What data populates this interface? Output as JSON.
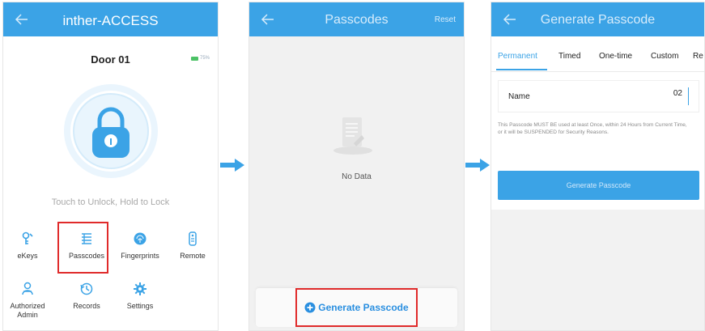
{
  "screen1": {
    "title": "inther-ACCESS",
    "door_name": "Door 01",
    "battery_text": "75%",
    "hint": "Touch to Unlock, Hold to Lock",
    "menu": [
      {
        "label": "eKeys",
        "icon": "ekeys-icon"
      },
      {
        "label": "Passcodes",
        "icon": "passcodes-icon"
      },
      {
        "label": "Fingerprints",
        "icon": "fingerprint-icon"
      },
      {
        "label": "Remote",
        "icon": "remote-icon"
      },
      {
        "label": "Authorized Admin",
        "icon": "admin-icon"
      },
      {
        "label": "Records",
        "icon": "records-icon"
      },
      {
        "label": "Settings",
        "icon": "settings-icon"
      }
    ],
    "highlighted_item": "Passcodes"
  },
  "screen2": {
    "title": "Passcodes",
    "reset_label": "Reset",
    "empty_text": "No Data",
    "generate_label": "Generate Passcode"
  },
  "screen3": {
    "title": "Generate Passcode",
    "tabs": [
      "Permanent",
      "Timed",
      "One-time",
      "Custom",
      "Re"
    ],
    "active_tab": "Permanent",
    "name_label": "Name",
    "name_value": "02",
    "notice": "This Passcode MUST BE used at least Once, within 24 Hours from Current Time, or it will be SUSPENDED for Security Reasons.",
    "submit_label": "Generate Passcode"
  },
  "colors": {
    "primary": "#3ba3e6",
    "highlight": "#e02b2b",
    "flow_arrow": "#3ba3e6"
  }
}
